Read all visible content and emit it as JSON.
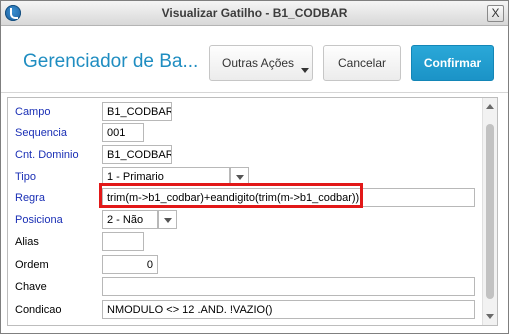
{
  "window": {
    "title": "Visualizar Gatilho - B1_CODBAR",
    "close_label": "X"
  },
  "header": {
    "page_title": "Gerenciador de Ba...",
    "outras_acoes_label": "Outras Ações",
    "cancelar_label": "Cancelar",
    "confirmar_label": "Confirmar"
  },
  "form": {
    "rows": [
      {
        "label": "Campo",
        "value": "B1_CODBAR"
      },
      {
        "label": "Sequencia",
        "value": "001"
      },
      {
        "label": "Cnt. Dominio",
        "value": "B1_CODBAR"
      },
      {
        "label": "Tipo",
        "value": "1 - Primario"
      },
      {
        "label": "Regra",
        "value": "trim(m->b1_codbar)+eandigito(trim(m->b1_codbar))"
      },
      {
        "label": "Posiciona",
        "value": "2 - Não"
      },
      {
        "label": "Alias",
        "value": ""
      },
      {
        "label": "Ordem",
        "value": "0"
      },
      {
        "label": "Chave",
        "value": ""
      },
      {
        "label": "Condicao",
        "value": "NMODULO <> 12 .AND. !VAZIO()"
      }
    ]
  },
  "colors": {
    "accent": "#1f8dc1",
    "confirm_button": "#1b93c7",
    "required_label": "#1a2fb5",
    "highlight_box": "#e21818"
  },
  "icons": {
    "app": "app-logo-icon",
    "close": "close-icon",
    "dropdown": "chevron-down-icon"
  }
}
